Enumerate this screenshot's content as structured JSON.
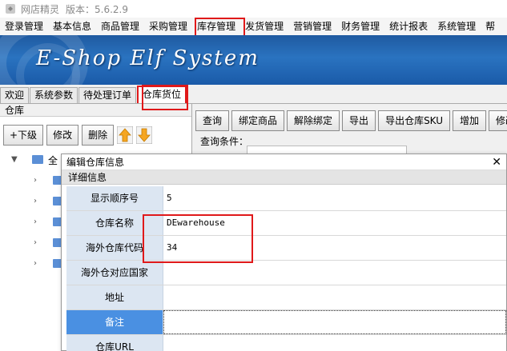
{
  "titlebar": {
    "app_name": "网店精灵",
    "version": "版本：5.6.2.9"
  },
  "menu": {
    "items": [
      "登录管理",
      "基本信息",
      "商品管理",
      "采购管理",
      "库存管理",
      "发货管理",
      "营销管理",
      "财务管理",
      "统计报表",
      "系统管理",
      "帮"
    ]
  },
  "banner": {
    "logo_text": "E-Shop Elf System"
  },
  "tabs": [
    "欢迎",
    "系统参数",
    "待处理订单",
    "仓库货位"
  ],
  "left_panel": {
    "title": "仓库",
    "buttons": {
      "add_child": "+下级",
      "edit": "修改",
      "delete": "删除"
    },
    "tree_root_label": "全"
  },
  "right_panel": {
    "buttons": [
      "查询",
      "绑定商品",
      "解除绑定",
      "导出",
      "导出仓库SKU",
      "增加",
      "修改"
    ],
    "query_label": "查询条件："
  },
  "dialog": {
    "title": "编辑仓库信息",
    "close_glyph": "✕",
    "section": "详细信息",
    "fields": [
      {
        "label": "显示顺序号",
        "value": "5"
      },
      {
        "label": "仓库名称",
        "value": "DEwarehouse"
      },
      {
        "label": "海外仓库代码",
        "value": "34"
      },
      {
        "label": "海外仓对应国家",
        "value": ""
      },
      {
        "label": "地址",
        "value": ""
      },
      {
        "label": "备注",
        "value": ""
      },
      {
        "label": "仓库URL",
        "value": ""
      }
    ]
  },
  "colors": {
    "highlight": "#e0191a",
    "selected_row": "#4a90e2",
    "label_bg": "#dce6f2"
  }
}
